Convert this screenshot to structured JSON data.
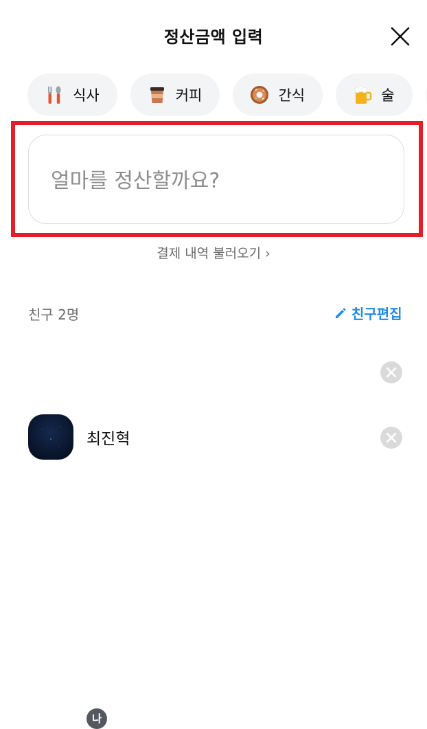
{
  "header": {
    "title": "정산금액 입력",
    "close_icon": "close-icon"
  },
  "categories": [
    {
      "label": "식사",
      "icon": "fork-knife-icon"
    },
    {
      "label": "커피",
      "icon": "coffee-cup-icon"
    },
    {
      "label": "간식",
      "icon": "donut-icon"
    },
    {
      "label": "술",
      "icon": "beer-icon"
    },
    {
      "label": "",
      "icon": "taxi-icon"
    }
  ],
  "amount": {
    "placeholder": "얼마를 정산할까요?",
    "value": ""
  },
  "load_history": "결제 내역 불러오기 ›",
  "friends": {
    "count_label": "친구 2명",
    "edit_label": "친구편집",
    "me_badge": "나",
    "list": [
      {
        "name": "",
        "is_me": true
      },
      {
        "name": "최진혁",
        "is_me": false
      }
    ]
  },
  "colors": {
    "accent": "#1a8be6",
    "highlight": "#e21f26",
    "chip_bg": "#f3f4f6"
  }
}
